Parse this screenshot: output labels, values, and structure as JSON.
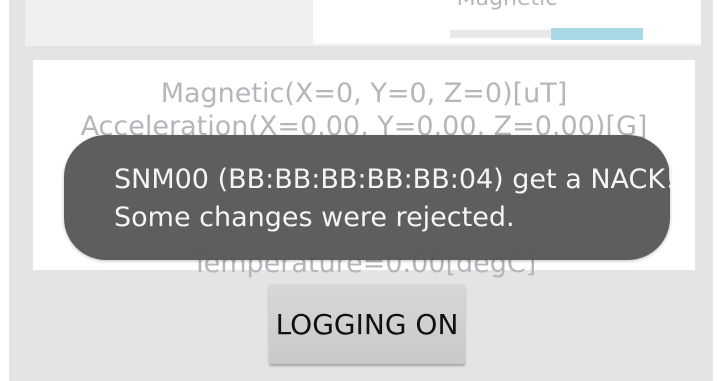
{
  "top_card": {
    "title": "Magnetic"
  },
  "sensor_readings": [
    "Magnetic(X=0, Y=0, Z=0)[uT]",
    "Acceleration(X=0.00, Y=0.00, Z=0.00)[G]",
    "Temperature=0.00[degC]"
  ],
  "toast": {
    "line1": "SNM00 (BB:BB:BB:BB:BB:04) get a NACK!",
    "line2": "Some changes were rejected."
  },
  "logging_button": {
    "label": "LOGGING ON"
  },
  "colors": {
    "background": "#e3e4e5",
    "card": "#ffffff",
    "toast": "#555555",
    "muted_text": "#b3b7bb",
    "progress_fill": "#a9d9e4"
  }
}
